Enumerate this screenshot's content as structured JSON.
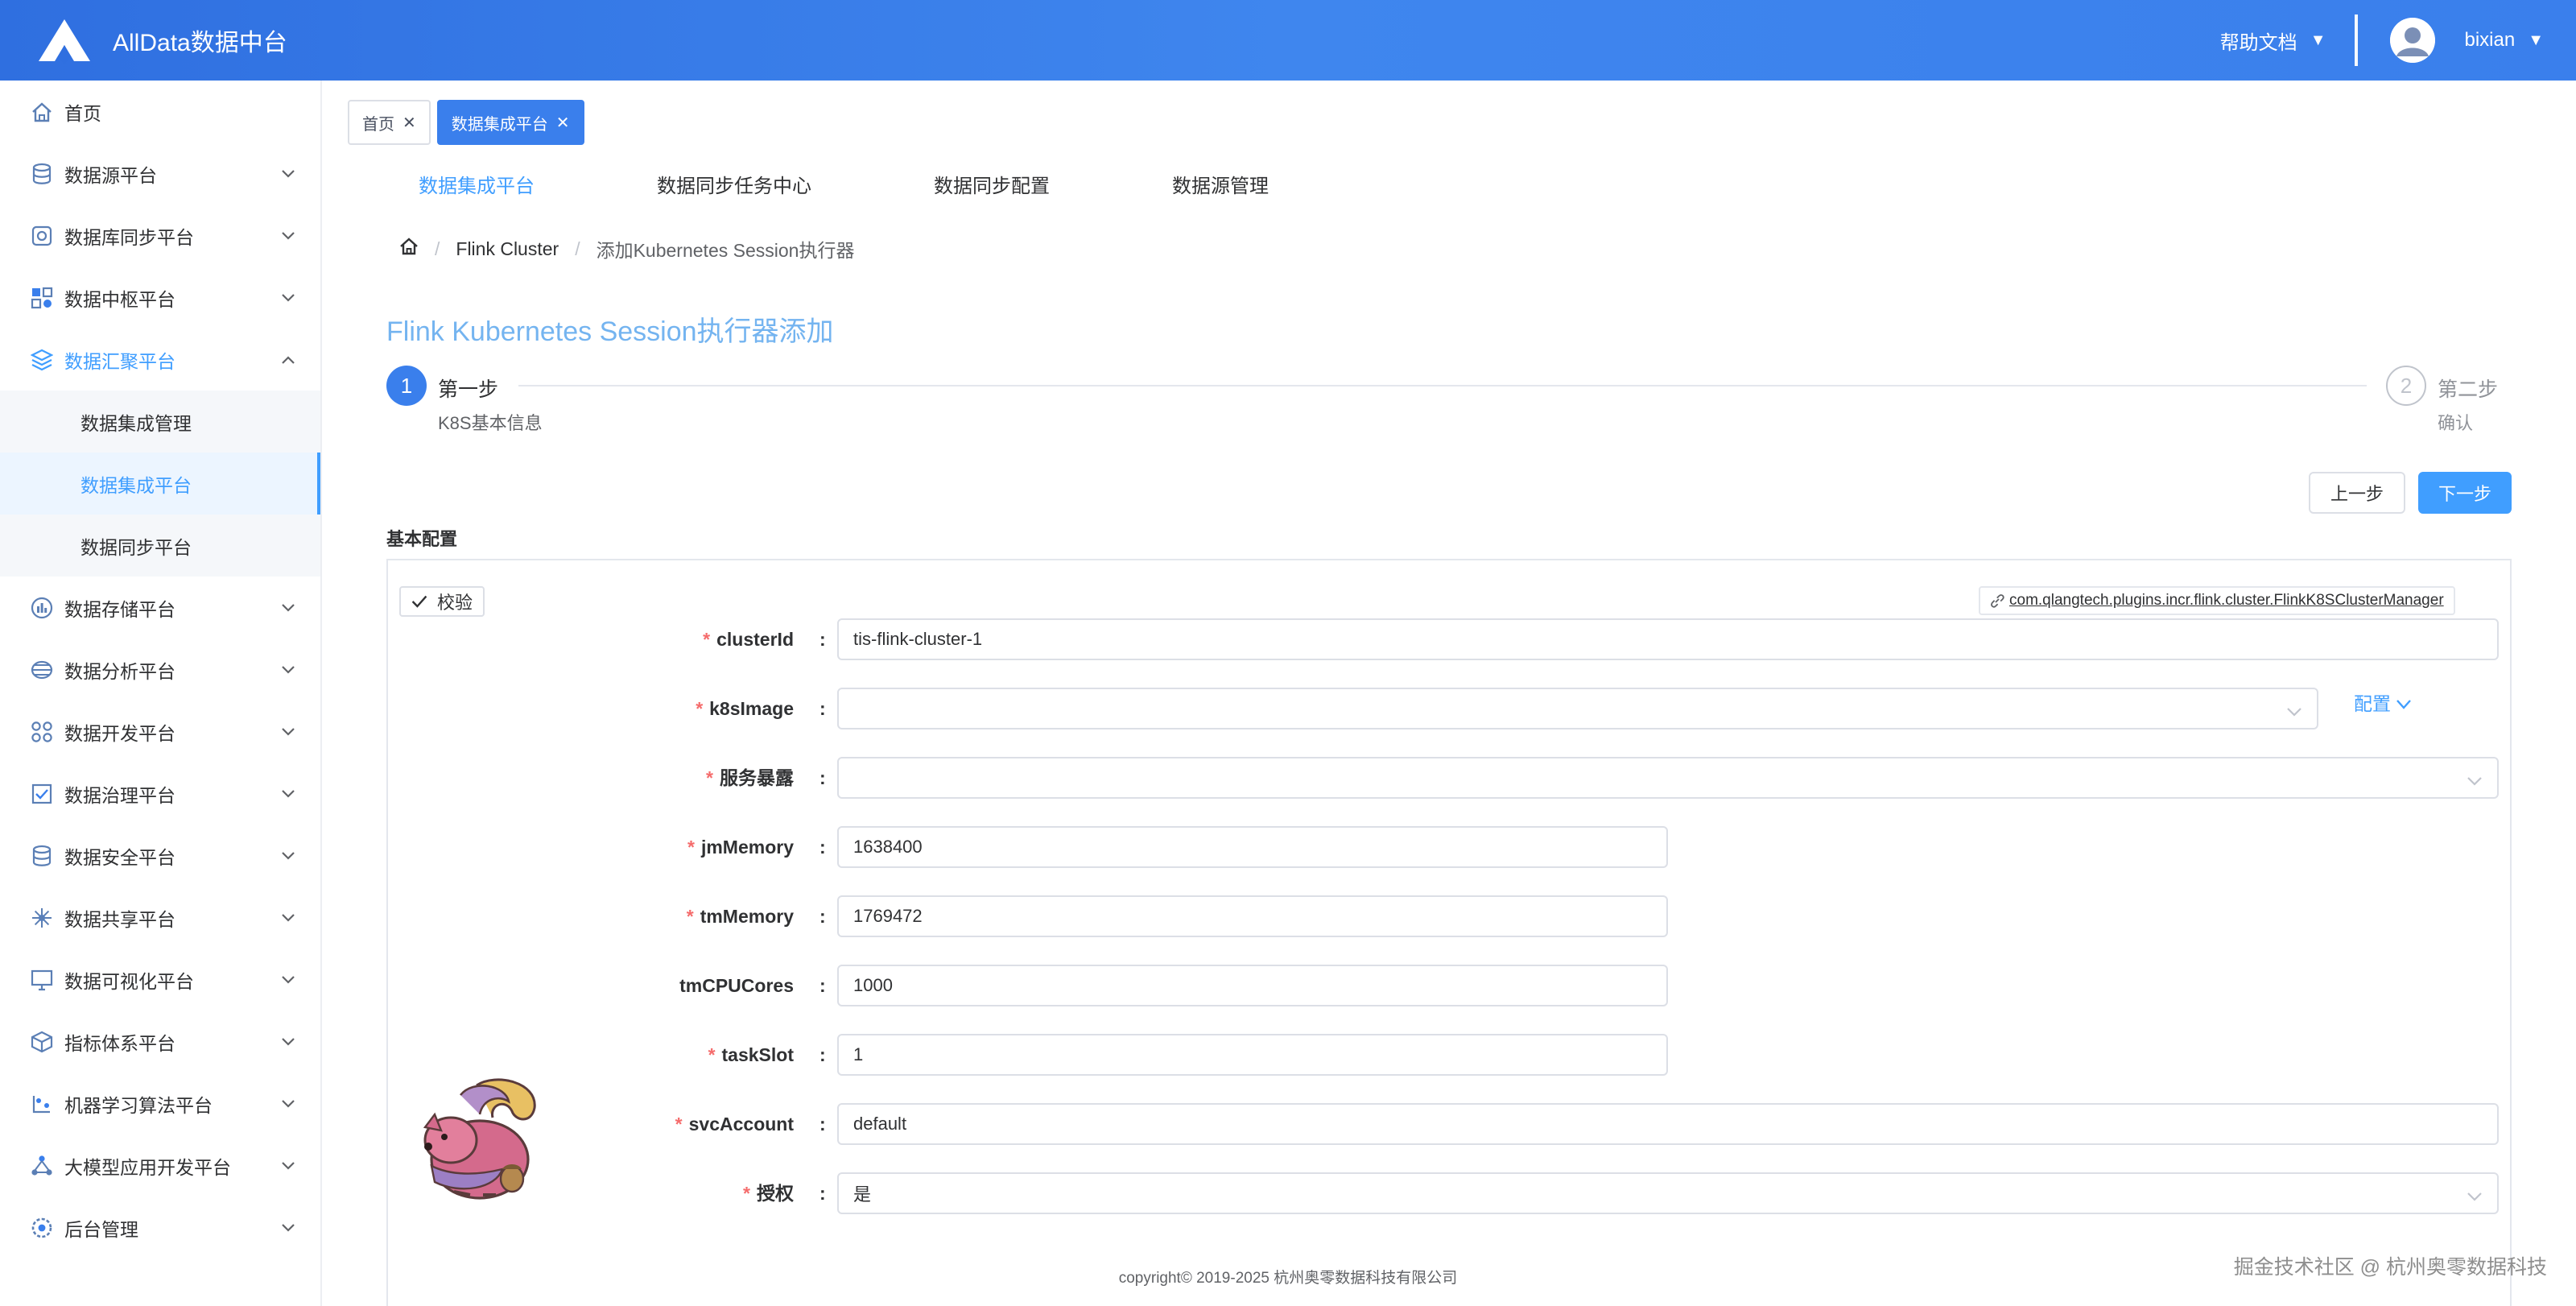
{
  "header": {
    "app_title": "AllData数据中台",
    "help_label": "帮助文档",
    "caret": "▼",
    "username": "bixian"
  },
  "sidebar": {
    "items": [
      {
        "label": "首页",
        "icon": "home-icon",
        "expandable": false
      },
      {
        "label": "数据源平台",
        "icon": "database-icon",
        "expandable": true
      },
      {
        "label": "数据库同步平台",
        "icon": "sync-icon",
        "expandable": true
      },
      {
        "label": "数据中枢平台",
        "icon": "hub-icon",
        "expandable": true
      },
      {
        "label": "数据汇聚平台",
        "icon": "layers-icon",
        "expandable": true,
        "open": true,
        "children": [
          {
            "label": "数据集成管理",
            "active": false
          },
          {
            "label": "数据集成平台",
            "active": true
          },
          {
            "label": "数据同步平台",
            "active": false
          }
        ]
      },
      {
        "label": "数据存储平台",
        "icon": "storage-icon",
        "expandable": true
      },
      {
        "label": "数据分析平台",
        "icon": "analysis-icon",
        "expandable": true
      },
      {
        "label": "数据开发平台",
        "icon": "dev-icon",
        "expandable": true
      },
      {
        "label": "数据治理平台",
        "icon": "governance-icon",
        "expandable": true
      },
      {
        "label": "数据安全平台",
        "icon": "security-icon",
        "expandable": true
      },
      {
        "label": "数据共享平台",
        "icon": "share-icon",
        "expandable": true
      },
      {
        "label": "数据可视化平台",
        "icon": "monitor-icon",
        "expandable": true
      },
      {
        "label": "指标体系平台",
        "icon": "cube-icon",
        "expandable": true
      },
      {
        "label": "机器学习算法平台",
        "icon": "ml-icon",
        "expandable": true
      },
      {
        "label": "大模型应用开发平台",
        "icon": "network-icon",
        "expandable": true
      },
      {
        "label": "后台管理",
        "icon": "settings-icon",
        "expandable": true
      }
    ]
  },
  "tabs": [
    {
      "label": "首页",
      "active": false
    },
    {
      "label": "数据集成平台",
      "active": true
    }
  ],
  "topnav": [
    {
      "label": "数据集成平台",
      "active": true
    },
    {
      "label": "数据同步任务中心",
      "active": false
    },
    {
      "label": "数据同步配置",
      "active": false
    },
    {
      "label": "数据源管理",
      "active": false
    }
  ],
  "breadcrumb": {
    "cluster": "Flink Cluster",
    "current": "添加Kubernetes Session执行器",
    "separator": "/"
  },
  "page_title": "Flink Kubernetes Session执行器添加",
  "steps": [
    {
      "number": "1",
      "title": "第一步",
      "desc": "K8S基本信息",
      "status": "active"
    },
    {
      "number": "2",
      "title": "第二步",
      "desc": "确认",
      "status": "wait"
    }
  ],
  "buttons": {
    "prev": "上一步",
    "next": "下一步"
  },
  "section_title": "基本配置",
  "form": {
    "check_label": "校验",
    "plugin_class": "com.qlangtech.plugins.incr.flink.cluster.FlinkK8SClusterManager",
    "config_label": "配置",
    "colon": ":",
    "required_mark": "*",
    "fields": [
      {
        "label": "clusterId",
        "value": "tis-flink-cluster-1",
        "required": true,
        "type": "text"
      },
      {
        "label": "k8sImage",
        "value": "",
        "required": true,
        "type": "select"
      },
      {
        "label": "服务暴露",
        "value": "",
        "required": true,
        "type": "select"
      },
      {
        "label": "jmMemory",
        "value": "1638400",
        "required": true,
        "type": "text"
      },
      {
        "label": "tmMemory",
        "value": "1769472",
        "required": true,
        "type": "text"
      },
      {
        "label": "tmCPUCores",
        "value": "1000",
        "required": false,
        "type": "text"
      },
      {
        "label": "taskSlot",
        "value": "1",
        "required": true,
        "type": "text"
      },
      {
        "label": "svcAccount",
        "value": "default",
        "required": true,
        "type": "text"
      },
      {
        "label": "授权",
        "value": "是",
        "required": true,
        "type": "select"
      }
    ]
  },
  "footer": "copyright© 2019-2025 杭州奥零数据科技有限公司",
  "watermark": "掘金技术社区 @ 杭州奥零数据科技",
  "colors": {
    "header": "#3a7fec",
    "accent": "#409eff",
    "title": "#74b4f0",
    "required": "#f56c6c"
  }
}
